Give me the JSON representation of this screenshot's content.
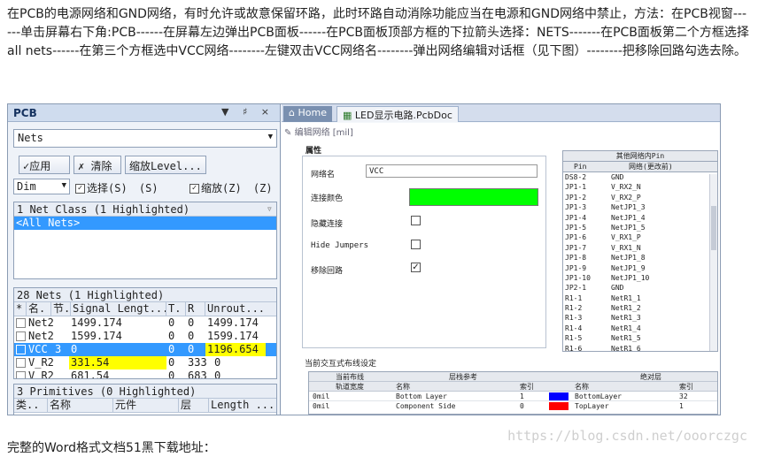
{
  "article": {
    "paragraph": "在PCB的电源网络和GND网络，有时允许或故意保留环路，此时环路自动消除功能应当在电源和GND网络中禁止，方法：在PCB视窗------单击屏幕右下角:PCB------在屏幕左边弹出PCB面板------在PCB面板顶部方框的下拉箭头选择：NETS-------在PCB面板第二个方框选择all nets------在第三个方框选中VCC网络--------左键双击VCC网络名--------弹出网络编辑对话框（见下图）--------把移除回路勾选去除。",
    "footer": "完整的Word格式文档51黑下载地址：",
    "watermark": "https://blog.csdn.net/ooorczgc"
  },
  "pcb_panel": {
    "title": "PCB",
    "pin_controls": "▼ ♯ ×",
    "mode": "Nets",
    "apply_label": "✓应用",
    "clear_label": "✗ 清除",
    "zoom_level_label": "缩放Level...",
    "dim_value": "Dim",
    "select_label": "选择(S)",
    "select_hint": "(S)",
    "zoom_label": "缩放(Z)",
    "zoom_hint": "(Z)",
    "net_class_header": "1 Net Class (1 Highlighted)",
    "net_class_item": "<All Nets>",
    "nets_header": "28 Nets (1 Highlighted)",
    "nets_columns": [
      "*",
      "名.",
      "节.",
      "Signal Lengt...",
      "T.",
      "R",
      "Unrout..."
    ],
    "nets_rows": [
      {
        "name": "Net2",
        "nodes": "",
        "signal": "1499.174",
        "t": "0",
        "r": "0",
        "unrouted": "1499.174"
      },
      {
        "name": "Net2",
        "nodes": "",
        "signal": "1599.174",
        "t": "0",
        "r": "0",
        "unrouted": "1599.174"
      },
      {
        "name": "VCC",
        "nodes": "3",
        "signal": "0",
        "t": "0",
        "r": "0",
        "unrouted": "1196.654"
      },
      {
        "name": "V_R2",
        "nodes": "",
        "signal": "331.54",
        "t": "0",
        "r": "333",
        "unrouted": "0"
      },
      {
        "name": "V_R2",
        "nodes": "",
        "signal": "681.54",
        "t": "0",
        "r": "683",
        "unrouted": "0"
      }
    ],
    "primitives_header": "3 Primitives (0 Highlighted)",
    "primitives_columns": [
      "类..",
      "名称",
      "元件",
      "层",
      "Length ..."
    ]
  },
  "tabs": {
    "home": "Home",
    "doc": "LED显示电路.PcbDoc"
  },
  "dialog": {
    "title": "编辑网络 [mil]",
    "properties_label": "属性",
    "net_name_label": "网络名",
    "net_name_value": "VCC",
    "connection_color_label": "连接颜色",
    "connection_color": "#00ff00",
    "hide_connections_label": "隐藏连接",
    "hide_jumpers_label": "Hide Jumpers",
    "remove_loops_label": "移除回路",
    "remove_loops_checked": true,
    "other_pins_title": "其他网络内Pin",
    "pin_col": "Pin",
    "net_col": "网络(更改前)",
    "pins": [
      [
        "DS8-2",
        "GND"
      ],
      [
        "JP1-1",
        "V_RX2_N"
      ],
      [
        "JP1-2",
        "V_RX2_P"
      ],
      [
        "JP1-3",
        "NetJP1_3"
      ],
      [
        "JP1-4",
        "NetJP1_4"
      ],
      [
        "JP1-5",
        "NetJP1_5"
      ],
      [
        "JP1-6",
        "V_RX1_P"
      ],
      [
        "JP1-7",
        "V_RX1_N"
      ],
      [
        "JP1-8",
        "NetJP1_8"
      ],
      [
        "JP1-9",
        "NetJP1_9"
      ],
      [
        "JP1-10",
        "NetJP1_10"
      ],
      [
        "JP2-1",
        "GND"
      ],
      [
        "R1-1",
        "NetR1_1"
      ],
      [
        "R1-2",
        "NetR1_2"
      ],
      [
        "R1-3",
        "NetR1_3"
      ],
      [
        "R1-4",
        "NetR1_4"
      ],
      [
        "R1-5",
        "NetR1_5"
      ],
      [
        "R1-6",
        "NetR1_6"
      ]
    ],
    "routing_section": "当前交互式布线设定",
    "current_routing": "当前布线",
    "track_width": "轨道宽度",
    "layer_ref": "层栈参考",
    "absolute_layer": "绝对层",
    "name_col": "名称",
    "index_col": "索引",
    "routing_rows": [
      {
        "width": "0mil",
        "ref_name": "Bottom Layer",
        "ref_index": "1",
        "color": "#0000ff",
        "abs_name": "BottomLayer",
        "abs_index": "32"
      },
      {
        "width": "0mil",
        "ref_name": "Component Side",
        "ref_index": "0",
        "color": "#ff0000",
        "abs_name": "TopLayer",
        "abs_index": "1"
      }
    ]
  }
}
